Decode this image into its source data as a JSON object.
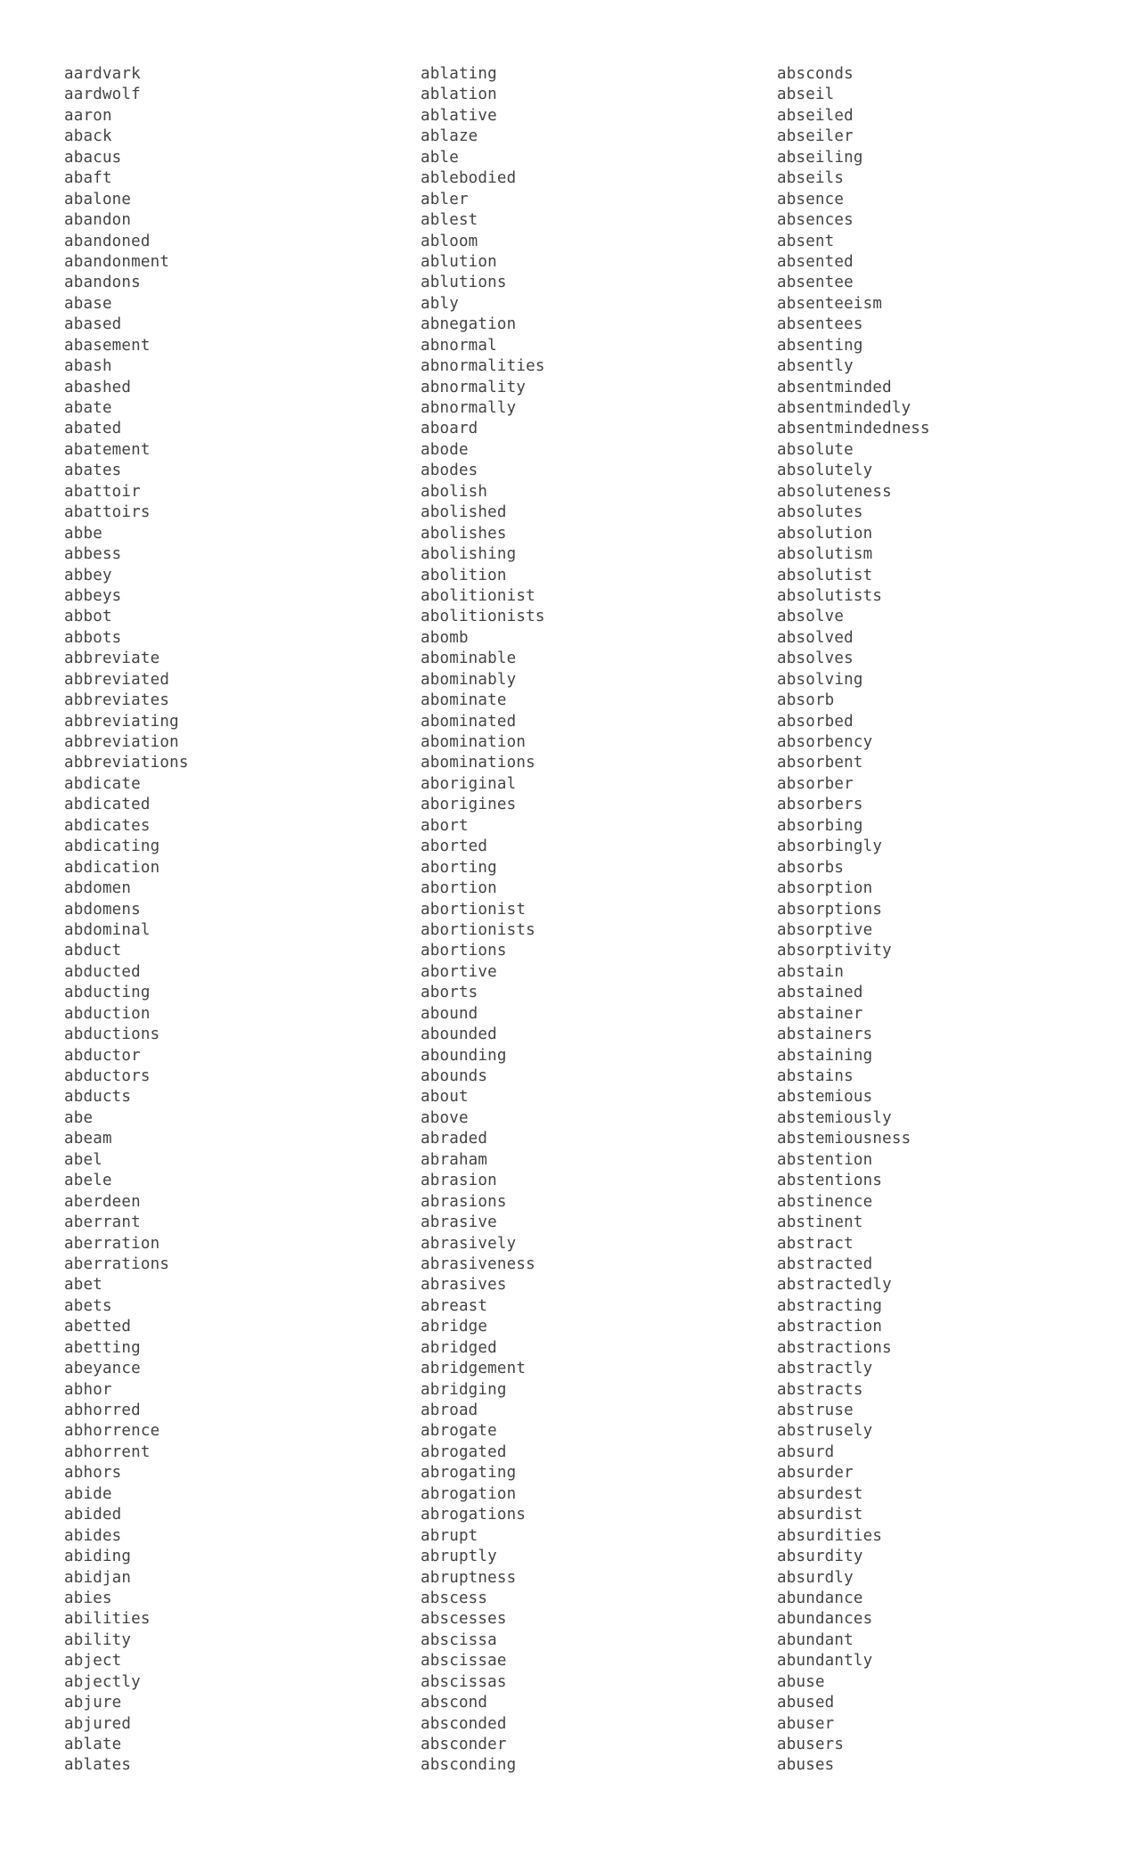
{
  "document": {
    "kind": "word-list",
    "layout": "three-column alphabetical word list",
    "background_color": "#ffffff",
    "text_color": "#434343",
    "columns_count": 3,
    "rows_per_column": 80
  },
  "columns": [
    {
      "name": "column-1",
      "first_word": "aardvark",
      "last_word": "ablates",
      "words": [
        "aardvark",
        "aardwolf",
        "aaron",
        "aback",
        "abacus",
        "abaft",
        "abalone",
        "abandon",
        "abandoned",
        "abandonment",
        "abandons",
        "abase",
        "abased",
        "abasement",
        "abash",
        "abashed",
        "abate",
        "abated",
        "abatement",
        "abates",
        "abattoir",
        "abattoirs",
        "abbe",
        "abbess",
        "abbey",
        "abbeys",
        "abbot",
        "abbots",
        "abbreviate",
        "abbreviated",
        "abbreviates",
        "abbreviating",
        "abbreviation",
        "abbreviations",
        "abdicate",
        "abdicated",
        "abdicates",
        "abdicating",
        "abdication",
        "abdomen",
        "abdomens",
        "abdominal",
        "abduct",
        "abducted",
        "abducting",
        "abduction",
        "abductions",
        "abductor",
        "abductors",
        "abducts",
        "abe",
        "abeam",
        "abel",
        "abele",
        "aberdeen",
        "aberrant",
        "aberration",
        "aberrations",
        "abet",
        "abets",
        "abetted",
        "abetting",
        "abeyance",
        "abhor",
        "abhorred",
        "abhorrence",
        "abhorrent",
        "abhors",
        "abide",
        "abided",
        "abides",
        "abiding",
        "abidjan",
        "abies",
        "abilities",
        "ability",
        "abject",
        "abjectly",
        "abjure",
        "abjured",
        "ablate",
        "ablates"
      ]
    },
    {
      "name": "column-2",
      "first_word": "ablating",
      "last_word": "absconding",
      "words": [
        "ablating",
        "ablation",
        "ablative",
        "ablaze",
        "able",
        "ablebodied",
        "abler",
        "ablest",
        "abloom",
        "ablution",
        "ablutions",
        "ably",
        "abnegation",
        "abnormal",
        "abnormalities",
        "abnormality",
        "abnormally",
        "aboard",
        "abode",
        "abodes",
        "abolish",
        "abolished",
        "abolishes",
        "abolishing",
        "abolition",
        "abolitionist",
        "abolitionists",
        "abomb",
        "abominable",
        "abominably",
        "abominate",
        "abominated",
        "abomination",
        "abominations",
        "aboriginal",
        "aborigines",
        "abort",
        "aborted",
        "aborting",
        "abortion",
        "abortionist",
        "abortionists",
        "abortions",
        "abortive",
        "aborts",
        "abound",
        "abounded",
        "abounding",
        "abounds",
        "about",
        "above",
        "abraded",
        "abraham",
        "abrasion",
        "abrasions",
        "abrasive",
        "abrasively",
        "abrasiveness",
        "abrasives",
        "abreast",
        "abridge",
        "abridged",
        "abridgement",
        "abridging",
        "abroad",
        "abrogate",
        "abrogated",
        "abrogating",
        "abrogation",
        "abrogations",
        "abrupt",
        "abruptly",
        "abruptness",
        "abscess",
        "abscesses",
        "abscissa",
        "abscissae",
        "abscissas",
        "abscond",
        "absconded",
        "absconder",
        "absconding"
      ]
    },
    {
      "name": "column-3",
      "first_word": "absconds",
      "last_word": "abuses",
      "words": [
        "absconds",
        "abseil",
        "abseiled",
        "abseiler",
        "abseiling",
        "abseils",
        "absence",
        "absences",
        "absent",
        "absented",
        "absentee",
        "absenteeism",
        "absentees",
        "absenting",
        "absently",
        "absentminded",
        "absentmindedly",
        "absentmindedness",
        "absolute",
        "absolutely",
        "absoluteness",
        "absolutes",
        "absolution",
        "absolutism",
        "absolutist",
        "absolutists",
        "absolve",
        "absolved",
        "absolves",
        "absolving",
        "absorb",
        "absorbed",
        "absorbency",
        "absorbent",
        "absorber",
        "absorbers",
        "absorbing",
        "absorbingly",
        "absorbs",
        "absorption",
        "absorptions",
        "absorptive",
        "absorptivity",
        "abstain",
        "abstained",
        "abstainer",
        "abstainers",
        "abstaining",
        "abstains",
        "abstemious",
        "abstemiously",
        "abstemiousness",
        "abstention",
        "abstentions",
        "abstinence",
        "abstinent",
        "abstract",
        "abstracted",
        "abstractedly",
        "abstracting",
        "abstraction",
        "abstractions",
        "abstractly",
        "abstracts",
        "abstruse",
        "abstrusely",
        "absurd",
        "absurder",
        "absurdest",
        "absurdist",
        "absurdities",
        "absurdity",
        "absurdly",
        "abundance",
        "abundances",
        "abundant",
        "abundantly",
        "abuse",
        "abused",
        "abuser",
        "abusers",
        "abuses"
      ]
    }
  ]
}
